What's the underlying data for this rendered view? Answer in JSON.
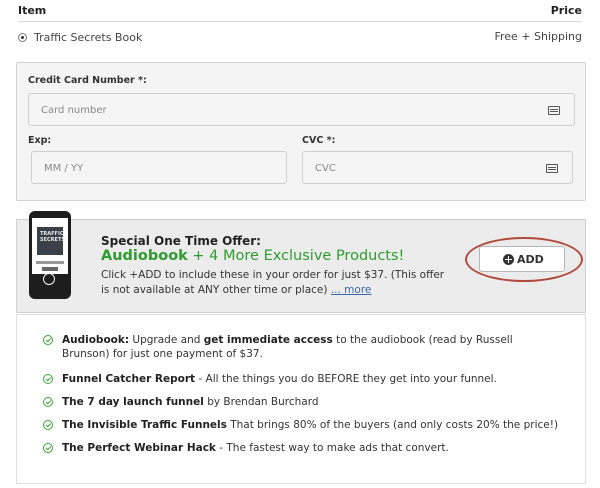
{
  "header": {
    "item_label": "Item",
    "price_label": "Price"
  },
  "product": {
    "name": "Traffic Secrets Book",
    "price": "Free + Shipping",
    "selected": true
  },
  "payment": {
    "card_number_label": "Credit Card Number *:",
    "card_number_placeholder": "Card number",
    "exp_label": "Exp:",
    "exp_placeholder": "MM / YY",
    "cvc_label": "CVC *:",
    "cvc_placeholder": "CVC"
  },
  "offer": {
    "heading": "Special One Time Offer:",
    "subheading_bold": "Audiobook",
    "subheading_rest": " + 4 More Exclusive Products!",
    "description": "Click +ADD to include these in your order for just $37. (This offer is not available at ANY other time or place) ",
    "more_link": "... more",
    "add_button_label": "ADD",
    "book_cover_text": "TRAFFIC SECRETS"
  },
  "benefits": [
    {
      "title": "Audiobook:",
      "t1": " Upgrade and ",
      "b2": "get immediate access",
      "t3": " to the audiobook (read by Russell Brunson) for just one payment of $37."
    },
    {
      "title": "Funnel Catcher Report",
      "t1": " - All the things you do BEFORE they get into your funnel.",
      "b2": "",
      "t3": ""
    },
    {
      "title": "The 7 day launch funnel",
      "t1": " by Brendan Burchard",
      "b2": "",
      "t3": ""
    },
    {
      "title": "The Invisible Traffic Funnels",
      "t1": " That brings 80% of the buyers (and only costs 20% the price!)",
      "b2": "",
      "t3": ""
    },
    {
      "title": "The Perfect Webinar Hack",
      "t1": " - The fastest way to make ads that convert.",
      "b2": "",
      "t3": ""
    }
  ],
  "colors": {
    "accent_green": "#2e9d2e",
    "highlight_circle": "#b04a3c",
    "link": "#3a66aa"
  }
}
